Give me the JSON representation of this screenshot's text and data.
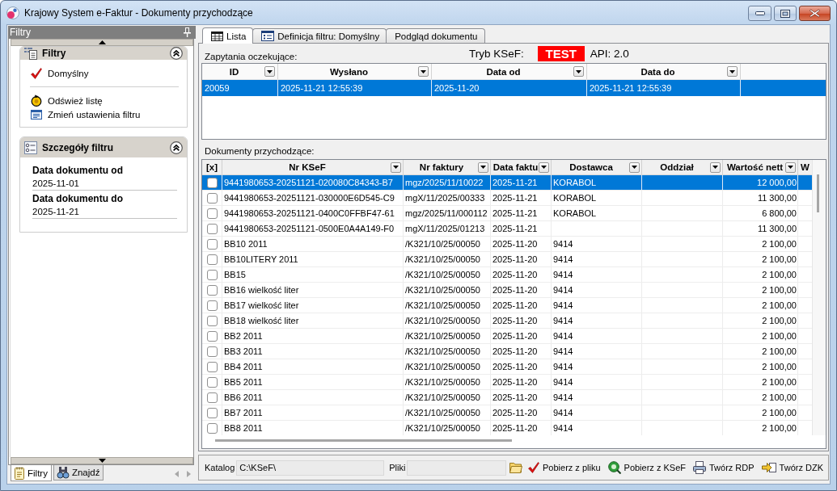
{
  "window": {
    "title": "Krajowy System e-Faktur - Dokumenty przychodzące"
  },
  "filter_pane": {
    "title": "Filtry",
    "sections": [
      {
        "kind": "actions",
        "title": "Filtry",
        "expanded": true,
        "filters": [
          {
            "label": "Domyślny",
            "selected": true
          }
        ],
        "actions": [
          {
            "kind": "refresh",
            "label": "Odśwież listę"
          },
          {
            "kind": "edit",
            "label": "Zmień ustawienia filtru"
          }
        ]
      },
      {
        "kind": "details",
        "title": "Szczegóły filtru",
        "expanded": true,
        "fields": [
          {
            "label": "Data dokumentu od",
            "value": "2025-11-01"
          },
          {
            "label": "Data dokumentu do",
            "value": "2025-11-21"
          }
        ]
      }
    ],
    "tabs": [
      {
        "label": "Filtry",
        "selected": true
      },
      {
        "label": "Znajdź",
        "selected": false
      }
    ]
  },
  "tabs": [
    {
      "label": "Lista",
      "selected": true
    },
    {
      "label": "Definicja filtru: Domyślny",
      "selected": false
    },
    {
      "label": "Podgląd dokumentu",
      "selected": false
    }
  ],
  "ksef_status": {
    "label": "Tryb KSeF:",
    "mode": "TEST",
    "api": "API: 2.0"
  },
  "pending_requests": {
    "label": "Zapytania oczekujące:",
    "columns": [
      "ID",
      "Wysłano",
      "Data od",
      "Data do"
    ],
    "rows": [
      {
        "selected": true,
        "cells": [
          "20059",
          "2025-11-21 12:55:39",
          "2025-11-20",
          "2025-11-21 12:55:39"
        ]
      }
    ]
  },
  "documents": {
    "label": "Dokumenty przychodzące:",
    "columns": [
      "[x]",
      "Nr KSeF",
      "Nr faktury",
      "Data faktu",
      "Dostawca",
      "Oddział",
      "Wartość nett",
      "W"
    ],
    "rows": [
      {
        "selected": true,
        "checked": false,
        "ksef_no": "9441980653-20251121-020080C84343-B7",
        "invoice_no": "mgz/2025/11/10022",
        "invoice_date": "2025-11-21",
        "supplier": "KORABOL",
        "net_value": "12 000,00"
      },
      {
        "selected": false,
        "checked": false,
        "ksef_no": "9441980653-20251121-030000E6D545-C9",
        "invoice_no": "mgX/11/2025/00333",
        "invoice_date": "2025-11-21",
        "supplier": "KORABOL",
        "net_value": "11 300,00"
      },
      {
        "selected": false,
        "checked": false,
        "ksef_no": "9441980653-20251121-0400C0FFBF47-61",
        "invoice_no": "mgz/2025/11/000112",
        "invoice_date": "2025-11-21",
        "supplier": "KORABOL",
        "net_value": "6 800,00"
      },
      {
        "selected": false,
        "checked": false,
        "ksef_no": "9441980653-20251121-0500E0A4A149-F0",
        "invoice_no": "mgX/11/2025/01213",
        "invoice_date": "2025-11-21",
        "net_value": "11 300,00"
      },
      {
        "selected": false,
        "checked": false,
        "ksef_no": "BB10 2011",
        "invoice_no": "/K321/10/25/00050",
        "invoice_date": "2025-11-20",
        "supplier": "9414",
        "net_value": "2 100,00"
      },
      {
        "selected": false,
        "checked": false,
        "ksef_no": "BB10LITERY 2011",
        "invoice_no": "/K321/10/25/00050",
        "invoice_date": "2025-11-20",
        "supplier": "9414",
        "net_value": "2 100,00"
      },
      {
        "selected": false,
        "checked": false,
        "ksef_no": "BB15",
        "invoice_no": "/K321/10/25/00050",
        "invoice_date": "2025-11-20",
        "supplier": "9414",
        "net_value": "2 100,00"
      },
      {
        "selected": false,
        "checked": false,
        "ksef_no": "BB16 wielkość liter",
        "invoice_no": "/K321/10/25/00050",
        "invoice_date": "2025-11-20",
        "supplier": "9414",
        "net_value": "2 100,00"
      },
      {
        "selected": false,
        "checked": false,
        "ksef_no": "BB17 wielkość liter",
        "invoice_no": "/K321/10/25/00050",
        "invoice_date": "2025-11-20",
        "supplier": "9414",
        "net_value": "2 100,00"
      },
      {
        "selected": false,
        "checked": false,
        "ksef_no": "BB18 wielkość liter",
        "invoice_no": "/K321/10/25/00050",
        "invoice_date": "2025-11-20",
        "supplier": "9414",
        "net_value": "2 100,00"
      },
      {
        "selected": false,
        "checked": false,
        "ksef_no": "BB2 2011",
        "invoice_no": "/K321/10/25/00050",
        "invoice_date": "2025-11-20",
        "supplier": "9414",
        "net_value": "2 100,00"
      },
      {
        "selected": false,
        "checked": false,
        "ksef_no": "BB3 2011",
        "invoice_no": "/K321/10/25/00050",
        "invoice_date": "2025-11-20",
        "supplier": "9414",
        "net_value": "2 100,00"
      },
      {
        "selected": false,
        "checked": false,
        "ksef_no": "BB4 2011",
        "invoice_no": "/K321/10/25/00050",
        "invoice_date": "2025-11-20",
        "supplier": "9414",
        "net_value": "2 100,00"
      },
      {
        "selected": false,
        "checked": false,
        "ksef_no": "BB5 2011",
        "invoice_no": "/K321/10/25/00050",
        "invoice_date": "2025-11-20",
        "supplier": "9414",
        "net_value": "2 100,00"
      },
      {
        "selected": false,
        "checked": false,
        "ksef_no": "BB6 2011",
        "invoice_no": "/K321/10/25/00050",
        "invoice_date": "2025-11-20",
        "supplier": "9414",
        "net_value": "2 100,00"
      },
      {
        "selected": false,
        "checked": false,
        "ksef_no": "BB7 2011",
        "invoice_no": "/K321/10/25/00050",
        "invoice_date": "2025-11-20",
        "supplier": "9414",
        "net_value": "2 100,00"
      },
      {
        "selected": false,
        "checked": false,
        "ksef_no": "BB8 2011",
        "invoice_no": "/K321/10/25/00050",
        "invoice_date": "2025-11-20",
        "supplier": "9414",
        "net_value": "2 100,00"
      }
    ]
  },
  "toolbar": {
    "catalog": {
      "label": "Katalog",
      "value": "C:\\KSeF\\"
    },
    "files": {
      "label": "Pliki"
    },
    "buttons": [
      {
        "label": "Pobierz z pliku"
      },
      {
        "label": "Pobierz z KSeF"
      },
      {
        "label": "Twórz RDP"
      },
      {
        "label": "Twórz DZK"
      }
    ]
  }
}
